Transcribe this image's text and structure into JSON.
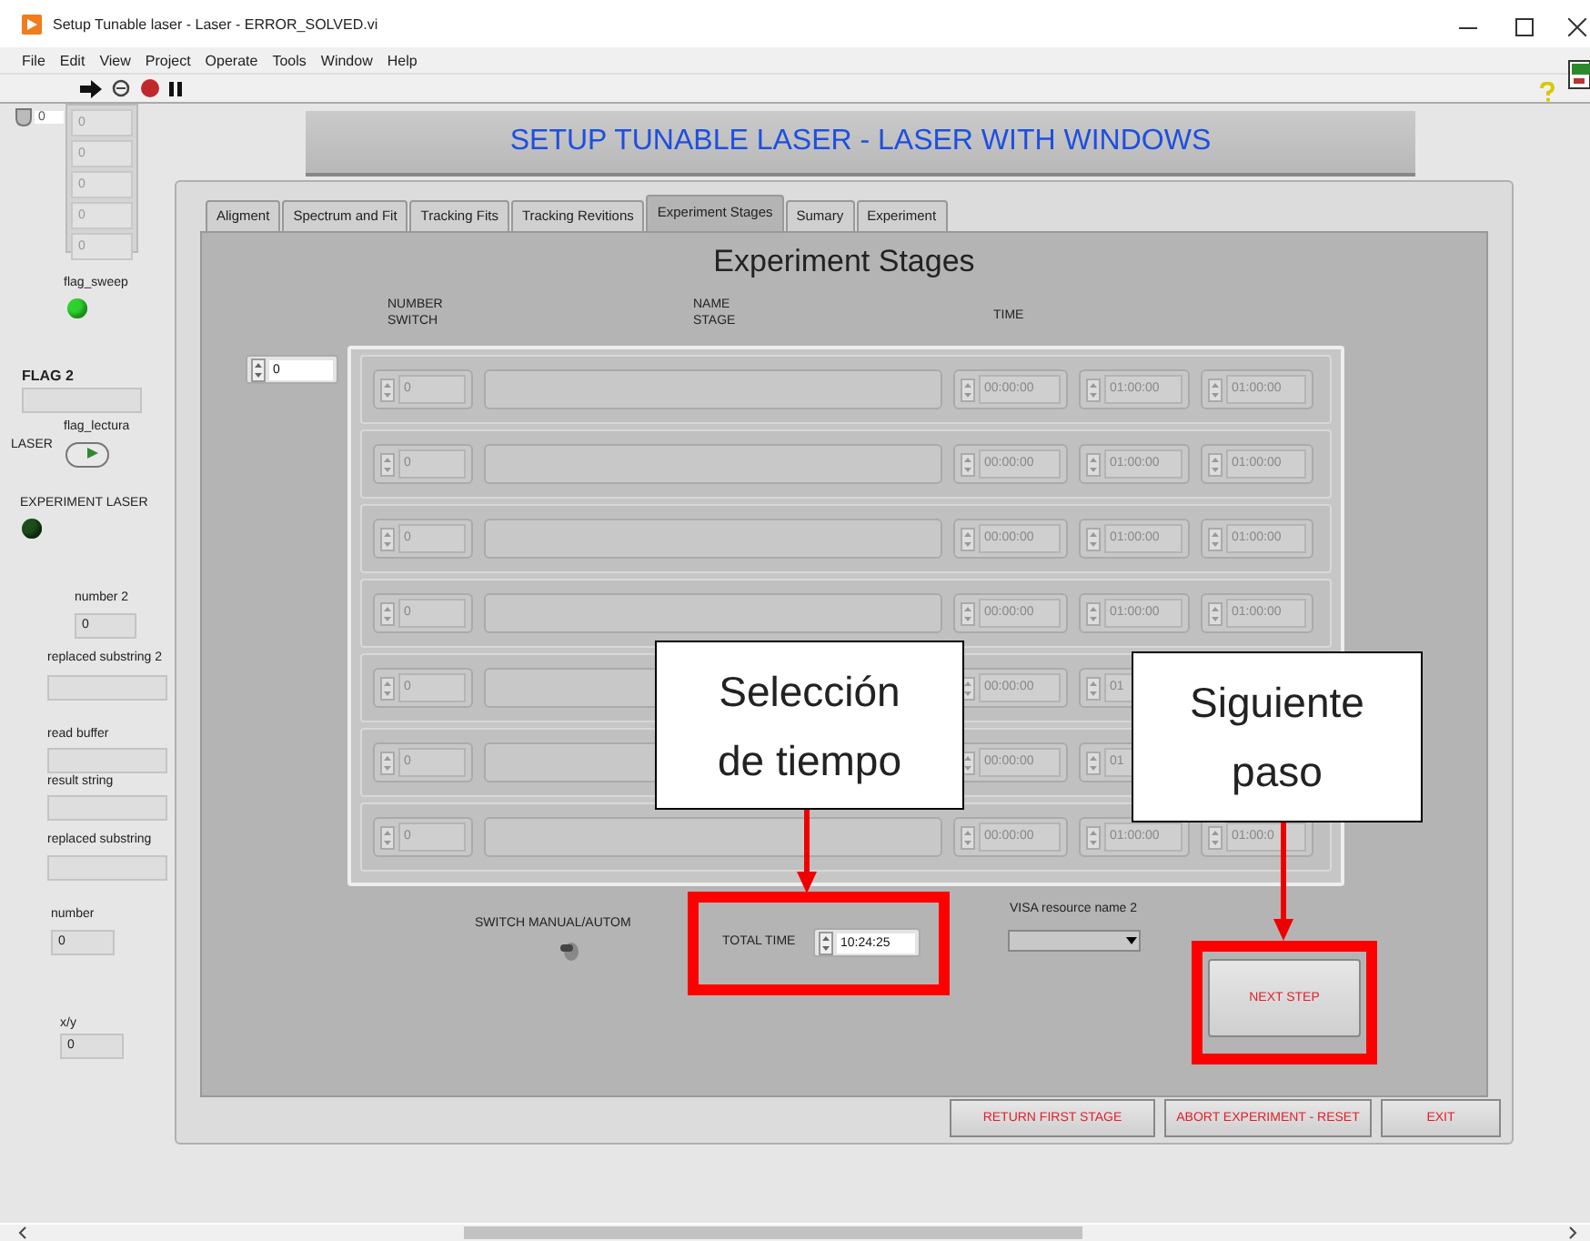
{
  "window": {
    "title": "Setup Tunable laser - Laser - ERROR_SOLVED.vi"
  },
  "menu": [
    "File",
    "Edit",
    "View",
    "Project",
    "Operate",
    "Tools",
    "Window",
    "Help"
  ],
  "left_panel": {
    "top_numeric": "0",
    "array_values": [
      "0",
      "0",
      "0",
      "0",
      "0"
    ],
    "flag_sweep": {
      "label": "flag_sweep",
      "on": true
    },
    "flag2": {
      "label": "FLAG 2"
    },
    "laser_label": "LASER",
    "flag_lectura": {
      "label": "flag_lectura",
      "on": true
    },
    "experiment_laser": {
      "label": "EXPERIMENT LASER",
      "on": false
    },
    "number2": {
      "label": "number 2",
      "value": "0"
    },
    "strings": [
      {
        "label": "replaced substring 2"
      },
      {
        "label": "read buffer"
      },
      {
        "label": "result string"
      },
      {
        "label": "replaced substring"
      }
    ],
    "number": {
      "label": "number",
      "value": "0"
    },
    "xy": {
      "label": "x/y",
      "value": "0"
    }
  },
  "banner": "SETUP TUNABLE LASER - LASER WITH WINDOWS",
  "tabs": [
    {
      "label": "Aligment",
      "selected": false
    },
    {
      "label": "Spectrum and Fit",
      "selected": false
    },
    {
      "label": "Tracking Fits",
      "selected": false
    },
    {
      "label": "Tracking Revitions",
      "selected": false
    },
    {
      "label": "Experiment Stages",
      "selected": true
    },
    {
      "label": "Sumary",
      "selected": false
    },
    {
      "label": "Experiment",
      "selected": false
    }
  ],
  "stages": {
    "heading": "Experiment Stages",
    "column_headers": [
      "NUMBER\nSWITCH",
      "NAME\nSTAGE",
      "TIME"
    ],
    "index": "0",
    "rows": [
      {
        "number": "0",
        "times": [
          "00:00:00",
          "01:00:00",
          "01:00:00"
        ]
      },
      {
        "number": "0",
        "times": [
          "00:00:00",
          "01:00:00",
          "01:00:00"
        ]
      },
      {
        "number": "0",
        "times": [
          "00:00:00",
          "01:00:00",
          "01:00:00"
        ]
      },
      {
        "number": "0",
        "times": [
          "00:00:00",
          "01:00:00",
          "01:00:00"
        ]
      },
      {
        "number": "0",
        "times": [
          "00:00:00",
          "01"
        ]
      },
      {
        "number": "0",
        "times": [
          "00:00:00",
          "01"
        ]
      },
      {
        "number": "0",
        "times": [
          "00:00:00",
          "01:00:00",
          "01:00:0"
        ]
      }
    ],
    "switch": {
      "label": "SWITCH MANUAL/AUTOM",
      "on": false
    },
    "total_time": {
      "label": "TOTAL TIME",
      "value": "10:24:25"
    },
    "visa": {
      "label": "VISA resource name 2"
    },
    "next_button": "NEXT STEP"
  },
  "bottom_buttons": [
    "RETURN FIRST STAGE",
    "ABORT EXPERIMENT - RESET",
    "EXIT"
  ],
  "callouts": [
    {
      "text": "Selección\nde tiempo"
    },
    {
      "text": "Siguiente\npaso"
    }
  ]
}
